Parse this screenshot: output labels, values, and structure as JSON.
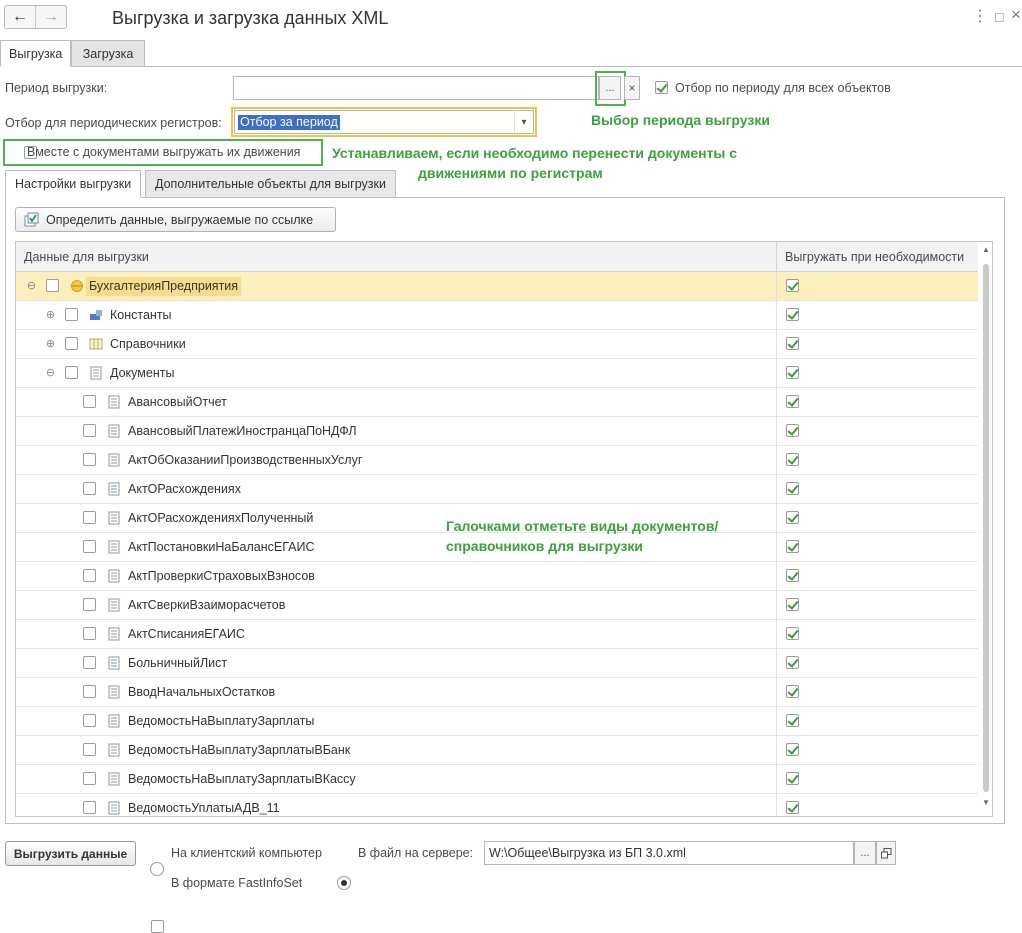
{
  "window": {
    "title": "Выгрузка и загрузка данных XML",
    "back_icon": "←",
    "forward_icon": "→",
    "more_icon": "⋮",
    "maximize_icon": "□",
    "close_icon": "×"
  },
  "top_tabs": [
    {
      "label": "Выгрузка",
      "active": true
    },
    {
      "label": "Загрузка",
      "active": false
    }
  ],
  "period": {
    "label": "Период выгрузки:",
    "value": "",
    "select_btn": "...",
    "clear_btn": "×",
    "all_objects_label": "Отбор по периоду для всех объектов",
    "all_objects_checked": true
  },
  "registers": {
    "label": "Отбор для периодических регистров:",
    "value": "Отбор за период",
    "dropdown_icon": "▾"
  },
  "movements": {
    "label": "Вместе с документами выгружать их движения",
    "checked": false
  },
  "annotations": {
    "period_hint": "Выбор периода выгрузки",
    "movements_hint_1": "Устанавливаем, если необходимо перенести документы с",
    "movements_hint_2": "движениями по регистрам",
    "checks_hint_1": "Галочками отметьте виды документов/",
    "checks_hint_2": "справочников для выгрузки"
  },
  "inner_tabs": [
    {
      "label": "Настройки выгрузки",
      "active": true
    },
    {
      "label": "Дополнительные объекты для выгрузки",
      "active": false
    }
  ],
  "define_button": {
    "label": "Определить данные, выгружаемые по ссылке"
  },
  "table": {
    "col1": "Данные для выгрузки",
    "col2": "Выгружать при необходимости",
    "rows": [
      {
        "level": 0,
        "expander": "⊖",
        "icon": "config-icon",
        "label": "БухгалтерияПредприятия",
        "checked": false,
        "export_if_needed": true,
        "selected": true
      },
      {
        "level": 1,
        "expander": "⊕",
        "icon": "constants-icon",
        "label": "Константы",
        "checked": false,
        "export_if_needed": true
      },
      {
        "level": 1,
        "expander": "⊕",
        "icon": "catalogs-icon",
        "label": "Справочники",
        "checked": false,
        "export_if_needed": true
      },
      {
        "level": 1,
        "expander": "⊖",
        "icon": "document-icon",
        "label": "Документы",
        "checked": false,
        "export_if_needed": true
      },
      {
        "level": 2,
        "icon": "document-icon",
        "label": "АвансовыйОтчет",
        "checked": false,
        "export_if_needed": true
      },
      {
        "level": 2,
        "icon": "document-icon",
        "label": "АвансовыйПлатежИностранцаПоНДФЛ",
        "checked": false,
        "export_if_needed": true
      },
      {
        "level": 2,
        "icon": "document-icon",
        "label": "АктОбОказанииПроизводственныхУслуг",
        "checked": false,
        "export_if_needed": true
      },
      {
        "level": 2,
        "icon": "document-icon",
        "label": "АктОРасхождениях",
        "checked": false,
        "export_if_needed": true
      },
      {
        "level": 2,
        "icon": "document-icon",
        "label": "АктОРасхожденияхПолученный",
        "checked": false,
        "export_if_needed": true
      },
      {
        "level": 2,
        "icon": "document-icon",
        "label": "АктПостановкиНаБалансЕГАИС",
        "checked": false,
        "export_if_needed": true
      },
      {
        "level": 2,
        "icon": "document-icon",
        "label": "АктПроверкиСтраховыхВзносов",
        "checked": false,
        "export_if_needed": true
      },
      {
        "level": 2,
        "icon": "document-icon",
        "label": "АктСверкиВзаиморасчетов",
        "checked": false,
        "export_if_needed": true
      },
      {
        "level": 2,
        "icon": "document-icon",
        "label": "АктСписанияЕГАИС",
        "checked": false,
        "export_if_needed": true
      },
      {
        "level": 2,
        "icon": "document-icon",
        "label": "БольничныйЛист",
        "checked": false,
        "export_if_needed": true
      },
      {
        "level": 2,
        "icon": "document-icon",
        "label": "ВводНачальныхОстатков",
        "checked": false,
        "export_if_needed": true
      },
      {
        "level": 2,
        "icon": "document-icon",
        "label": "ВедомостьНаВыплатуЗарплаты",
        "checked": false,
        "export_if_needed": true
      },
      {
        "level": 2,
        "icon": "document-icon",
        "label": "ВедомостьНаВыплатуЗарплатыВБанк",
        "checked": false,
        "export_if_needed": true
      },
      {
        "level": 2,
        "icon": "document-icon",
        "label": "ВедомостьНаВыплатуЗарплатыВКассу",
        "checked": false,
        "export_if_needed": true
      },
      {
        "level": 2,
        "icon": "document-icon",
        "label": "ВедомостьУплатыАДВ_11",
        "checked": false,
        "export_if_needed": true
      }
    ]
  },
  "bottom": {
    "export_button": "Выгрузить данные",
    "client_label": "На клиентский компьютер",
    "server_label": "В файл на сервере:",
    "server_selected": true,
    "server_path": "W:\\Общее\\Выгрузка из БП 3.0.xml",
    "path_select_btn": "...",
    "fastinfoset_label": "В формате FastInfoSet",
    "fastinfoset_checked": false
  }
}
